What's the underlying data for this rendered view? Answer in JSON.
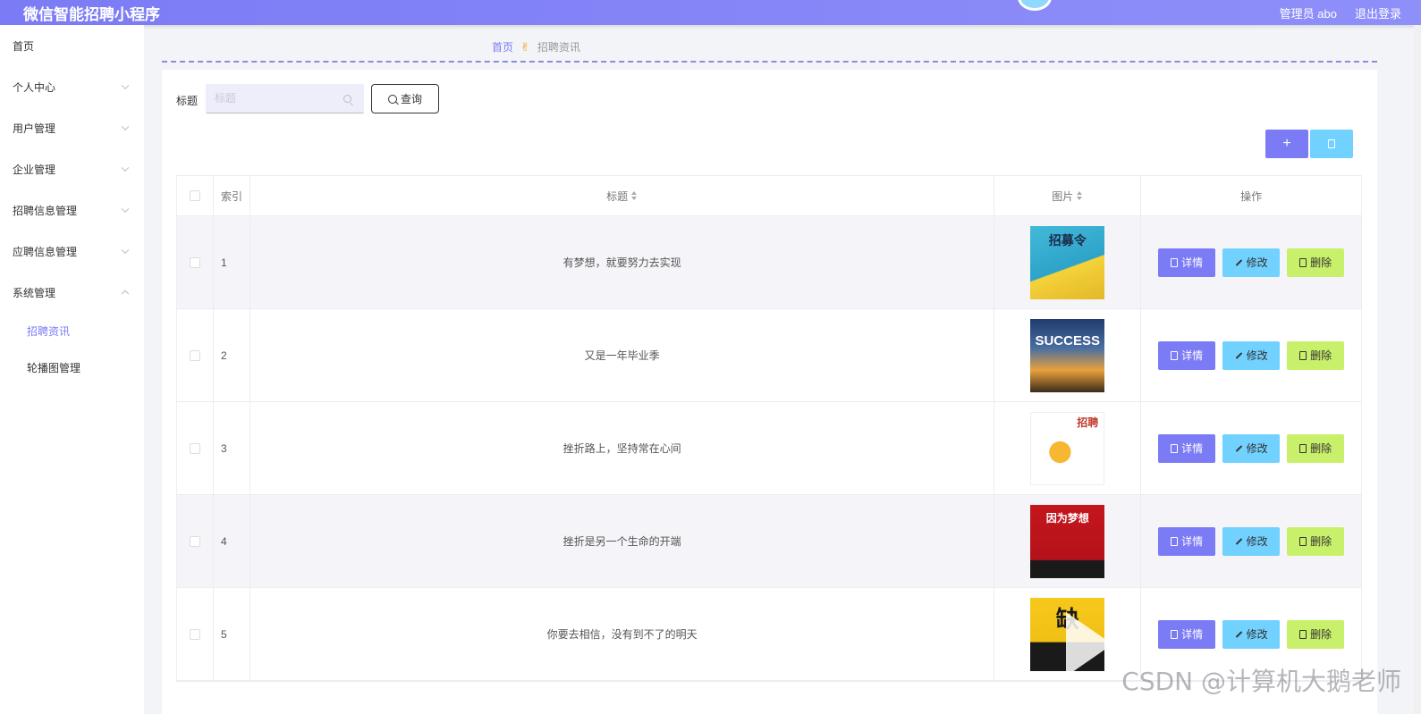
{
  "header": {
    "app_title": "微信智能招聘小程序",
    "admin": "管理员 abo",
    "logout": "退出登录"
  },
  "sidebar": {
    "items": [
      {
        "label": "首页"
      },
      {
        "label": "个人中心"
      },
      {
        "label": "用户管理"
      },
      {
        "label": "企业管理"
      },
      {
        "label": "招聘信息管理"
      },
      {
        "label": "应聘信息管理"
      },
      {
        "label": "系统管理"
      }
    ],
    "sub_items": [
      {
        "label": "招聘资讯",
        "active": true
      },
      {
        "label": "轮播图管理"
      }
    ]
  },
  "breadcrumb": {
    "home": "首页",
    "current": "招聘资讯"
  },
  "search": {
    "label": "标题",
    "placeholder": "标题",
    "query_label": "查询"
  },
  "toolbar": {
    "add_symbol": "+",
    "delete_icon": "trash-icon"
  },
  "table": {
    "headers": {
      "index": "索引",
      "title": "标题",
      "picture": "图片",
      "ops": "操作"
    },
    "ops": {
      "detail": "详情",
      "edit": "修改",
      "delete": "删除"
    },
    "rows": [
      {
        "index": "1",
        "title": "有梦想，就要努力去实现",
        "thumb_text": "招募令"
      },
      {
        "index": "2",
        "title": "又是一年毕业季",
        "thumb_text": "SUCCESS"
      },
      {
        "index": "3",
        "title": "挫折路上，坚持常在心间",
        "thumb_text": "招聘"
      },
      {
        "index": "4",
        "title": "挫折是另一个生命的开端",
        "thumb_text": "因为梦想"
      },
      {
        "index": "5",
        "title": "你要去相信，没有到不了的明天",
        "thumb_text": "缺"
      }
    ]
  },
  "watermark": "CSDN @计算机大鹅老师",
  "colors": {
    "primary": "#7b7bf5",
    "cyan": "#71d1ff",
    "lime": "#c9f06a"
  }
}
